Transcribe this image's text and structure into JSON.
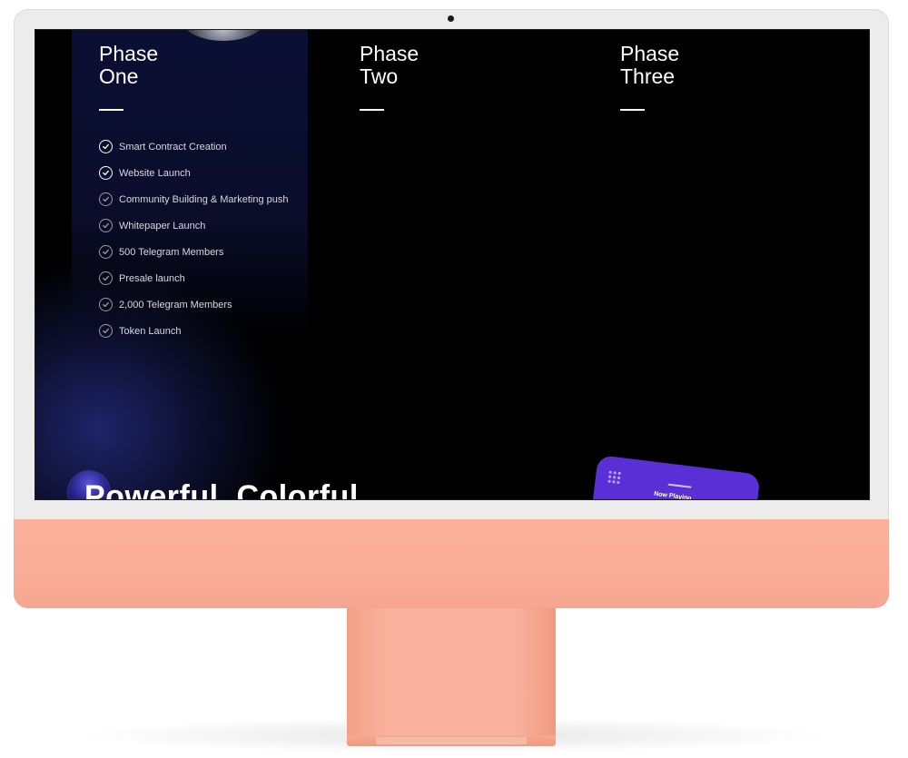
{
  "phases": [
    {
      "title": "Phase\nOne",
      "items": [
        {
          "label": "Smart Contract Creation",
          "done": true
        },
        {
          "label": "Website Launch",
          "done": true
        },
        {
          "label": "Community Building & Marketing push",
          "done": false
        },
        {
          "label": "Whitepaper Launch",
          "done": false
        },
        {
          "label": "500 Telegram Members",
          "done": false
        },
        {
          "label": "Presale launch",
          "done": false
        },
        {
          "label": "2,000 Telegram Members",
          "done": false
        },
        {
          "label": "Token Launch",
          "done": false
        }
      ]
    },
    {
      "title": "Phase\nTwo",
      "items": []
    },
    {
      "title": "Phase\nThree",
      "items": []
    }
  ],
  "section_heading": "Powerful. Colorful",
  "phone": {
    "label": "Now Playing"
  },
  "colors": {
    "screen_bg": "#000000",
    "card_bg": "#0b0f34",
    "phone_accent": "#5b2fd6",
    "imac_body": "#f9ad98"
  },
  "icons": {
    "check": "check-circle-icon"
  }
}
